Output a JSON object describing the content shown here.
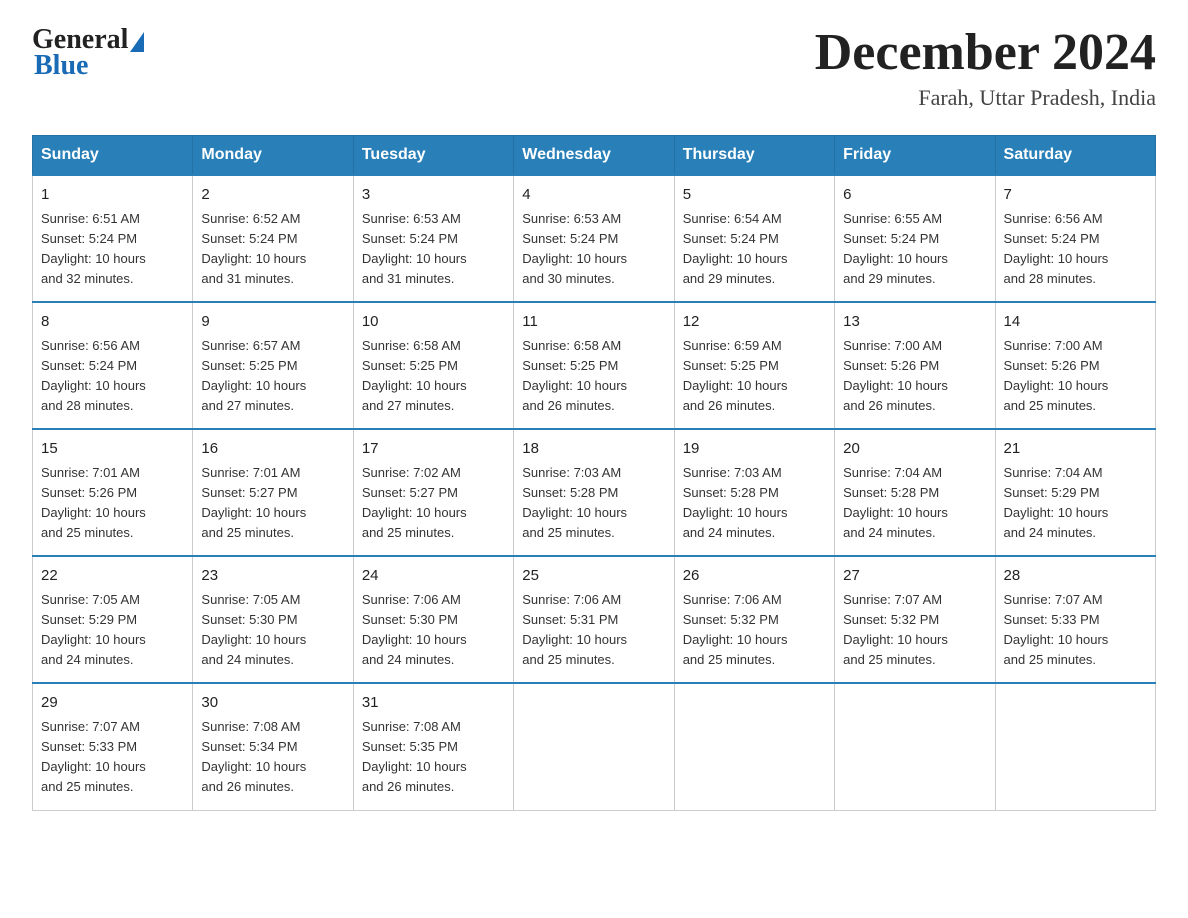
{
  "header": {
    "logo_general": "General",
    "logo_blue": "Blue",
    "title": "December 2024",
    "subtitle": "Farah, Uttar Pradesh, India"
  },
  "days_of_week": [
    "Sunday",
    "Monday",
    "Tuesday",
    "Wednesday",
    "Thursday",
    "Friday",
    "Saturday"
  ],
  "weeks": [
    [
      {
        "day": "1",
        "sunrise": "6:51 AM",
        "sunset": "5:24 PM",
        "daylight": "10 hours and 32 minutes."
      },
      {
        "day": "2",
        "sunrise": "6:52 AM",
        "sunset": "5:24 PM",
        "daylight": "10 hours and 31 minutes."
      },
      {
        "day": "3",
        "sunrise": "6:53 AM",
        "sunset": "5:24 PM",
        "daylight": "10 hours and 31 minutes."
      },
      {
        "day": "4",
        "sunrise": "6:53 AM",
        "sunset": "5:24 PM",
        "daylight": "10 hours and 30 minutes."
      },
      {
        "day": "5",
        "sunrise": "6:54 AM",
        "sunset": "5:24 PM",
        "daylight": "10 hours and 29 minutes."
      },
      {
        "day": "6",
        "sunrise": "6:55 AM",
        "sunset": "5:24 PM",
        "daylight": "10 hours and 29 minutes."
      },
      {
        "day": "7",
        "sunrise": "6:56 AM",
        "sunset": "5:24 PM",
        "daylight": "10 hours and 28 minutes."
      }
    ],
    [
      {
        "day": "8",
        "sunrise": "6:56 AM",
        "sunset": "5:24 PM",
        "daylight": "10 hours and 28 minutes."
      },
      {
        "day": "9",
        "sunrise": "6:57 AM",
        "sunset": "5:25 PM",
        "daylight": "10 hours and 27 minutes."
      },
      {
        "day": "10",
        "sunrise": "6:58 AM",
        "sunset": "5:25 PM",
        "daylight": "10 hours and 27 minutes."
      },
      {
        "day": "11",
        "sunrise": "6:58 AM",
        "sunset": "5:25 PM",
        "daylight": "10 hours and 26 minutes."
      },
      {
        "day": "12",
        "sunrise": "6:59 AM",
        "sunset": "5:25 PM",
        "daylight": "10 hours and 26 minutes."
      },
      {
        "day": "13",
        "sunrise": "7:00 AM",
        "sunset": "5:26 PM",
        "daylight": "10 hours and 26 minutes."
      },
      {
        "day": "14",
        "sunrise": "7:00 AM",
        "sunset": "5:26 PM",
        "daylight": "10 hours and 25 minutes."
      }
    ],
    [
      {
        "day": "15",
        "sunrise": "7:01 AM",
        "sunset": "5:26 PM",
        "daylight": "10 hours and 25 minutes."
      },
      {
        "day": "16",
        "sunrise": "7:01 AM",
        "sunset": "5:27 PM",
        "daylight": "10 hours and 25 minutes."
      },
      {
        "day": "17",
        "sunrise": "7:02 AM",
        "sunset": "5:27 PM",
        "daylight": "10 hours and 25 minutes."
      },
      {
        "day": "18",
        "sunrise": "7:03 AM",
        "sunset": "5:28 PM",
        "daylight": "10 hours and 25 minutes."
      },
      {
        "day": "19",
        "sunrise": "7:03 AM",
        "sunset": "5:28 PM",
        "daylight": "10 hours and 24 minutes."
      },
      {
        "day": "20",
        "sunrise": "7:04 AM",
        "sunset": "5:28 PM",
        "daylight": "10 hours and 24 minutes."
      },
      {
        "day": "21",
        "sunrise": "7:04 AM",
        "sunset": "5:29 PM",
        "daylight": "10 hours and 24 minutes."
      }
    ],
    [
      {
        "day": "22",
        "sunrise": "7:05 AM",
        "sunset": "5:29 PM",
        "daylight": "10 hours and 24 minutes."
      },
      {
        "day": "23",
        "sunrise": "7:05 AM",
        "sunset": "5:30 PM",
        "daylight": "10 hours and 24 minutes."
      },
      {
        "day": "24",
        "sunrise": "7:06 AM",
        "sunset": "5:30 PM",
        "daylight": "10 hours and 24 minutes."
      },
      {
        "day": "25",
        "sunrise": "7:06 AM",
        "sunset": "5:31 PM",
        "daylight": "10 hours and 25 minutes."
      },
      {
        "day": "26",
        "sunrise": "7:06 AM",
        "sunset": "5:32 PM",
        "daylight": "10 hours and 25 minutes."
      },
      {
        "day": "27",
        "sunrise": "7:07 AM",
        "sunset": "5:32 PM",
        "daylight": "10 hours and 25 minutes."
      },
      {
        "day": "28",
        "sunrise": "7:07 AM",
        "sunset": "5:33 PM",
        "daylight": "10 hours and 25 minutes."
      }
    ],
    [
      {
        "day": "29",
        "sunrise": "7:07 AM",
        "sunset": "5:33 PM",
        "daylight": "10 hours and 25 minutes."
      },
      {
        "day": "30",
        "sunrise": "7:08 AM",
        "sunset": "5:34 PM",
        "daylight": "10 hours and 26 minutes."
      },
      {
        "day": "31",
        "sunrise": "7:08 AM",
        "sunset": "5:35 PM",
        "daylight": "10 hours and 26 minutes."
      },
      null,
      null,
      null,
      null
    ]
  ],
  "labels": {
    "sunrise": "Sunrise:",
    "sunset": "Sunset:",
    "daylight": "Daylight:"
  }
}
